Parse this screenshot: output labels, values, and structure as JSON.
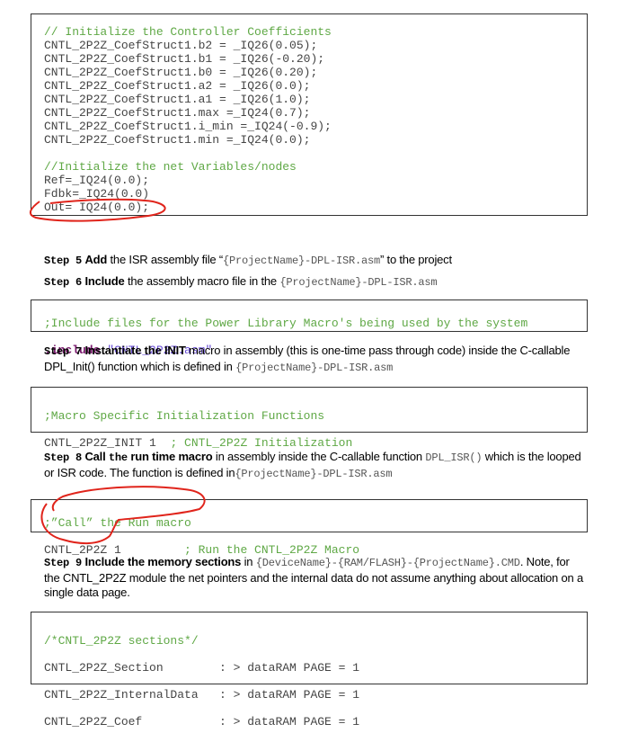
{
  "box1": {
    "lines": [
      {
        "text": "// Initialize the Controller Coefficients",
        "type": "comment"
      },
      {
        "text": "CNTL_2P2Z_CoefStruct1.b2 = _IQ26(0.05);",
        "type": "code"
      },
      {
        "text": "CNTL_2P2Z_CoefStruct1.b1 = _IQ26(-0.20);",
        "type": "code"
      },
      {
        "text": "CNTL_2P2Z_CoefStruct1.b0 = _IQ26(0.20);",
        "type": "code"
      },
      {
        "text": "CNTL_2P2Z_CoefStruct1.a2 = _IQ26(0.0);",
        "type": "code"
      },
      {
        "text": "CNTL_2P2Z_CoefStruct1.a1 = _IQ26(1.0);",
        "type": "code"
      },
      {
        "text": "CNTL_2P2Z_CoefStruct1.max =_IQ24(0.7);",
        "type": "code"
      },
      {
        "text": "CNTL_2P2Z_CoefStruct1.i_min =_IQ24(-0.9);",
        "type": "code"
      },
      {
        "text": "CNTL_2P2Z_CoefStruct1.min =_IQ24(0.0);",
        "type": "code"
      },
      {
        "text": "",
        "type": "code"
      },
      {
        "text": "//Initialize the net Variables/nodes",
        "type": "comment"
      },
      {
        "text": "Ref=_IQ24(0.0);",
        "type": "code"
      },
      {
        "text": "Fdbk=_IQ24(0.0)",
        "type": "code"
      },
      {
        "text": "Out= IQ24(0.0);",
        "type": "code"
      }
    ]
  },
  "step5": {
    "label": "Step 5",
    "bold": "Add",
    "t1": " the ISR assembly file “",
    "mono": "{ProjectName}-DPL-ISR.asm",
    "t2": "” to the project"
  },
  "step6": {
    "label": "Step 6",
    "bold": "Include",
    "t1": " the assembly macro file in the ",
    "mono": "{ProjectName}-DPL-ISR.asm"
  },
  "box2": {
    "comment": ";Include files for the Power Library Macro's being used by the system",
    "directive": ".include",
    "string": "\"CNTL_2P2Z.asm\""
  },
  "step7": {
    "label": "Step 7",
    "bold": "Instantiate the INIT",
    "t1": " macro in assembly (this is one-time pass through code) inside the C-callable DPL_Init() function which is defined in ",
    "mono": "{ProjectName}-DPL-ISR.asm"
  },
  "box3": {
    "comment": ";Macro Specific Initialization Functions",
    "code": "CNTL_2P2Z_INIT 1  ",
    "comment2": "; CNTL_2P2Z Initialization"
  },
  "step8": {
    "label": "Step 8",
    "bold": "Call",
    "mono_bold": "the",
    "bold2": "run time macro",
    "t1": " in assembly inside the C-callable function ",
    "mono": "DPL_ISR()",
    "t2": " which is the looped or ISR code. The function is defined in",
    "mono2": "{ProjectName}-DPL-ISR.asm"
  },
  "box4": {
    "comment": ";”Call” the Run macro",
    "code": "CNTL_2P2Z 1         ",
    "comment2": "; Run the CNTL_2P2Z Macro"
  },
  "step9": {
    "label": "Step 9",
    "bold": "Include the memory sections",
    "t1": " in ",
    "mono": "{DeviceName}-{RAM/FLASH}-{ProjectName}.CMD",
    "t2": ".  Note, for the CNTL_2P2Z module the net pointers and the internal data do not assume anything about allocation on a single data page."
  },
  "box5": {
    "comment": "/*CNTL_2P2Z sections*/",
    "lines": [
      "CNTL_2P2Z_Section        : > dataRAM PAGE = 1",
      "CNTL_2P2Z_InternalData   : > dataRAM PAGE = 1",
      "CNTL_2P2Z_Coef           : > dataRAM PAGE = 1"
    ]
  },
  "colors": {
    "annotation": "#e0241b",
    "comment": "#5fa845"
  }
}
